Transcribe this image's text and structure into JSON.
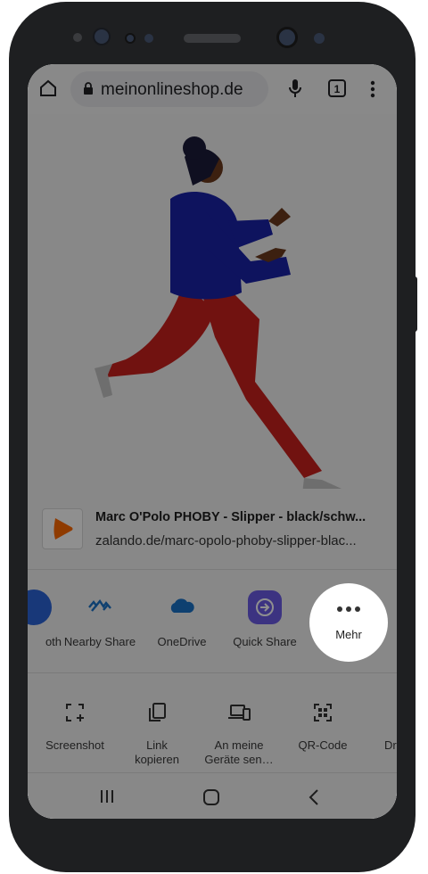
{
  "browser": {
    "url": "meinonlineshop.de",
    "tab_count": "1",
    "icons": [
      "home-icon",
      "lock-icon",
      "mic-icon",
      "tab-switcher-icon",
      "overflow-menu-icon"
    ]
  },
  "share_sheet": {
    "link_title": "Marc O'Polo PHOBY - Slipper - black/schw...",
    "link_url": "zalando.de/marc-opolo-phoby-slipper-blac...",
    "apps": [
      {
        "label": "oth"
      },
      {
        "label": "Nearby Share"
      },
      {
        "label": "OneDrive"
      },
      {
        "label": "Quick Share"
      },
      {
        "label": "Mehr"
      }
    ],
    "actions": [
      {
        "label": "Screenshot"
      },
      {
        "label": "Link kopieren"
      },
      {
        "label": "An meine Geräte sen…"
      },
      {
        "label": "QR-Code"
      },
      {
        "label": "Dr"
      }
    ]
  },
  "colors": {
    "phone_frame": "#1e1f21",
    "dim_overlay": "rgba(0,0,0,0.44)",
    "onedrive_blue": "#1a73c8",
    "quick_share_purple": "#6b5ce7",
    "zalando_orange": "#ff6900"
  }
}
